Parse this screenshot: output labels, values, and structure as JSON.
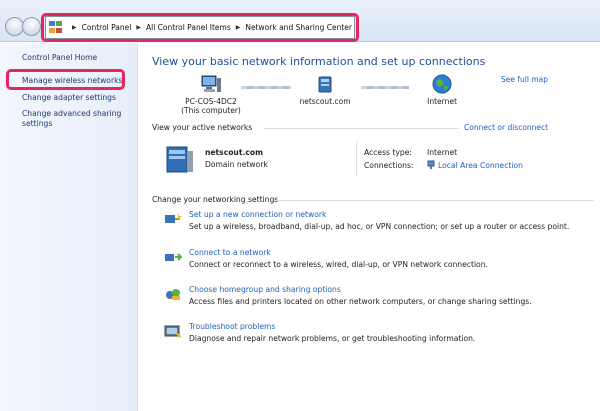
{
  "address_bar": {
    "breadcrumbs": [
      "Control Panel",
      "All Control Panel Items",
      "Network and Sharing Center"
    ]
  },
  "sidebar": {
    "home": "Control Panel Home",
    "links": [
      "Manage wireless networks",
      "Change adapter settings",
      "Change advanced sharing settings"
    ]
  },
  "main": {
    "title": "View your basic network information and set up connections",
    "see_full_map": "See full map",
    "map": {
      "computer_name": "PC-COS-4DC2",
      "computer_sub": "(This computer)",
      "network": "netscout.com",
      "internet": "Internet"
    },
    "active_networks": {
      "header": "View your active networks",
      "connect_link": "Connect or disconnect",
      "name": "netscout.com",
      "type": "Domain network",
      "access_type_label": "Access type:",
      "access_type_value": "Internet",
      "connections_label": "Connections:",
      "connections_value": "Local Area Connection"
    },
    "settings": {
      "header": "Change your networking settings",
      "tasks": [
        {
          "icon": "new-connection-icon",
          "title": "Set up a new connection or network",
          "desc": "Set up a wireless, broadband, dial-up, ad hoc, or VPN connection; or set up a router or access point."
        },
        {
          "icon": "connect-network-icon",
          "title": "Connect to a network",
          "desc": "Connect or reconnect to a wireless, wired, dial-up, or VPN network connection."
        },
        {
          "icon": "homegroup-icon",
          "title": "Choose homegroup and sharing options",
          "desc": "Access files and printers located on other network computers, or change sharing settings."
        },
        {
          "icon": "troubleshoot-icon",
          "title": "Troubleshoot problems",
          "desc": "Diagnose and repair network problems, or get troubleshooting information."
        }
      ]
    }
  },
  "colors": {
    "highlight": "#e8265e",
    "link": "#1f5fbf",
    "title": "#1e50a0"
  }
}
